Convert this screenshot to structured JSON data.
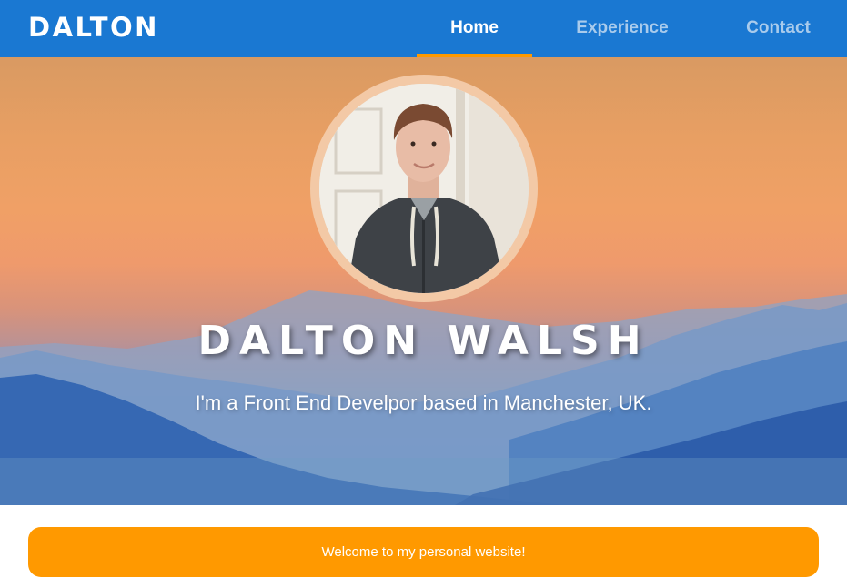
{
  "nav": {
    "brand": "DALTON",
    "items": [
      {
        "label": "Home",
        "active": true
      },
      {
        "label": "Experience",
        "active": false
      },
      {
        "label": "Contact",
        "active": false
      }
    ]
  },
  "hero": {
    "name": "DALTON WALSH",
    "tagline": "I'm a Front End Develpor based in Manchester, UK.",
    "avatar": "profile-photo"
  },
  "welcome": {
    "text": "Welcome to my personal website!"
  },
  "colors": {
    "nav_bg": "#1a78d2",
    "accent": "#ff9900",
    "nav_inactive": "#a9cbec",
    "text_light": "#ffffff"
  }
}
